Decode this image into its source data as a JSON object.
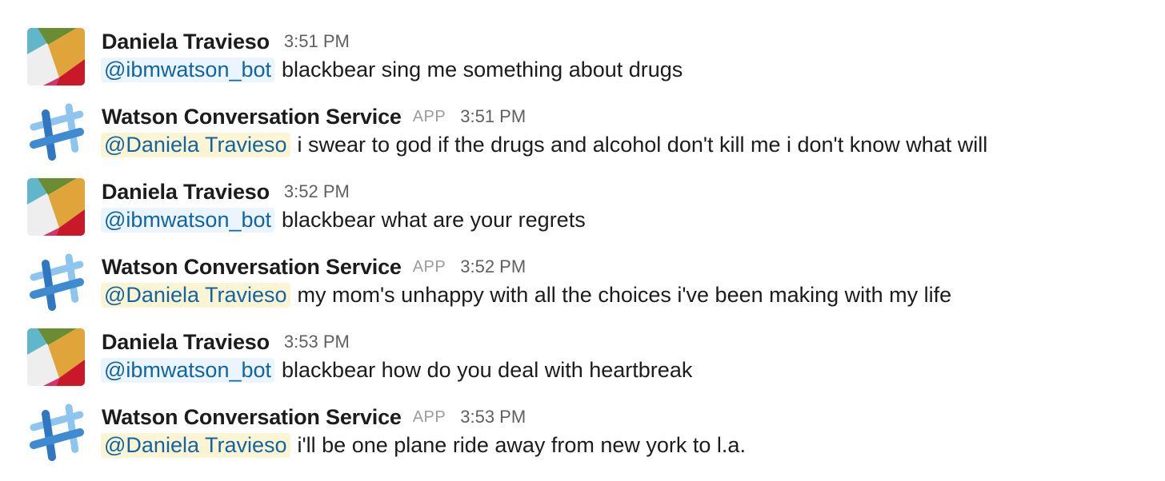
{
  "messages": [
    {
      "author": "Daniela Travieso",
      "kind": "user",
      "badge": "",
      "time": "3:51 PM",
      "mention": "@ibmwatson_bot",
      "text": "blackbear sing me something about drugs"
    },
    {
      "author": "Watson Conversation Service",
      "kind": "app",
      "badge": "APP",
      "time": "3:51 PM",
      "mention": "@Daniela Travieso",
      "text": "i swear to god if the drugs and alcohol don't kill me i don't know what will"
    },
    {
      "author": "Daniela Travieso",
      "kind": "user",
      "badge": "",
      "time": "3:52 PM",
      "mention": "@ibmwatson_bot",
      "text": "blackbear what are your regrets"
    },
    {
      "author": "Watson Conversation Service",
      "kind": "app",
      "badge": "APP",
      "time": "3:52 PM",
      "mention": "@Daniela Travieso",
      "text": "my mom's unhappy with all the choices i've been making with my life"
    },
    {
      "author": "Daniela Travieso",
      "kind": "user",
      "badge": "",
      "time": "3:53 PM",
      "mention": "@ibmwatson_bot",
      "text": "blackbear how do you deal with heartbreak"
    },
    {
      "author": "Watson Conversation Service",
      "kind": "app",
      "badge": "APP",
      "time": "3:53 PM",
      "mention": "@Daniela Travieso",
      "text": "i'll be one plane ride away from new york to l.a."
    }
  ],
  "colors": {
    "mention_text": "#1264a3",
    "bot_mention_bg": "#eaf5ff",
    "self_mention_bg": "#fdf4d4",
    "timestamp": "#616061",
    "app_badge": "#9b9b9b"
  },
  "icons": {
    "user_avatar": "slack-logo-avatar-icon",
    "app_avatar": "watson-hashtag-avatar-icon"
  }
}
